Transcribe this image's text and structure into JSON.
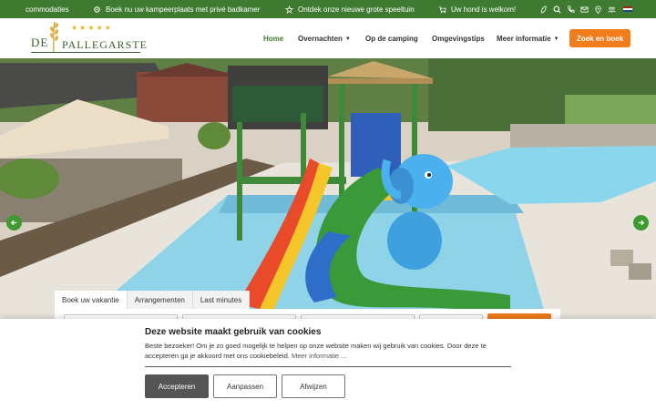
{
  "topbar": {
    "messages": [
      "commodaties",
      "Boek nu uw kampeerplaats met privé badkamer",
      "Ontdek onze nieuwe grote speeltuin",
      "Uw hond is welkom!"
    ],
    "icons": [
      "gear-icon",
      "star-cluster-icon",
      "cart-icon",
      "leaf-icon",
      "search-icon",
      "phone-icon",
      "mail-icon",
      "location-icon",
      "group-icon",
      "flag-nl-icon"
    ],
    "colors": {
      "bar": "#3f7a31"
    }
  },
  "header": {
    "logo": {
      "prefix": "DE",
      "name": "PALLEGARSTE",
      "stars": "★★★★★"
    },
    "nav": [
      {
        "label": "Home",
        "active": true,
        "dropdown": false
      },
      {
        "label": "Overnachten",
        "active": false,
        "dropdown": true
      },
      {
        "label": "Op de camping",
        "active": false,
        "dropdown": false
      },
      {
        "label": "Omgevingstips",
        "active": false,
        "dropdown": false
      },
      {
        "label": "Meer informatie",
        "active": false,
        "dropdown": true
      }
    ],
    "cta": "Zoek en boek",
    "colors": {
      "accent": "#3f7a31",
      "cta": "#f07c1b"
    }
  },
  "booking": {
    "tabs": [
      "Boek uw vakantie",
      "Arrangementen",
      "Last minutes"
    ]
  },
  "cookie": {
    "title": "Deze website maakt gebruik van cookies",
    "text": "Beste bezoeker! Om je zo goed mogelijk te helpen op onze website maken wij gebruik van cookies. Door deze te accepteren ga je akkoord met ons cookiebeleid.",
    "link": "Meer informatie ...",
    "buttons": {
      "accept": "Accepteren",
      "customize": "Aanpassen",
      "reject": "Afwijzen"
    }
  }
}
